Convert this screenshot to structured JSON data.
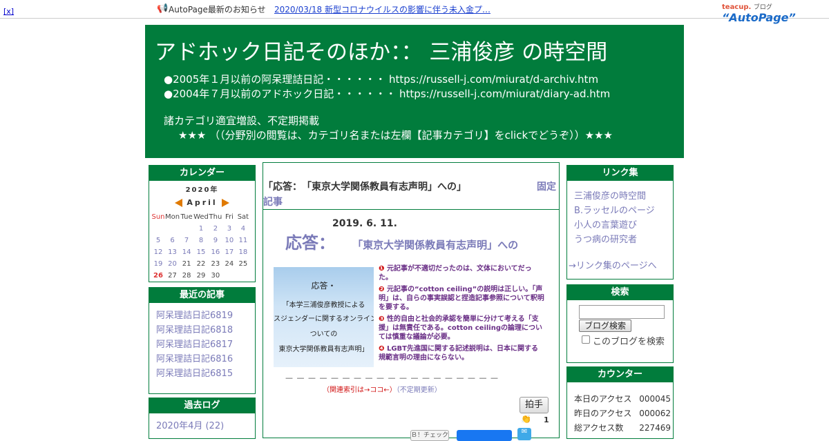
{
  "topbar": {
    "close": "[x]",
    "notice_label": "AutoPage最新のお知らせ",
    "notice_link": "2020/03/18 新型コロナウイルスの影響に伴う未入金プ…",
    "logo_teacup": "teacup.",
    "logo_blog": "ブログ",
    "logo_autopage": "“AutoPage”"
  },
  "header": {
    "title": "アドホック日記そのほか：： 三浦俊彦 の時空間",
    "line1": "●2005年１月以前の阿呆理詰日記・・・・・・ https://russell-j.com/miurat/d-archiv.htm",
    "line2": "●2004年７月以前のアドホック日記・・・・・・ https://russell-j.com/miurat/diary-ad.htm",
    "line3": "諸カテゴリ適宜増設、不定期掲載",
    "line4": "★★★ （（分野別の閲覧は、カテゴリ名または左欄【記事カテゴリ】をclickでどうぞ））★★★"
  },
  "calendar": {
    "title": "カレンダー",
    "year": "2020年",
    "month": "April",
    "weekdays": [
      "Sun",
      "Mon",
      "Tue",
      "Wed",
      "Thu",
      "Fri",
      "Sat"
    ],
    "weeks": [
      [
        "",
        "",
        "",
        "1",
        "2",
        "3",
        "4"
      ],
      [
        "5",
        "6",
        "7",
        "8",
        "9",
        "10",
        "11"
      ],
      [
        "12",
        "13",
        "14",
        "15",
        "16",
        "17",
        "18"
      ],
      [
        "19",
        "20",
        "21",
        "22",
        "23",
        "24",
        "25"
      ],
      [
        "26",
        "27",
        "28",
        "29",
        "30",
        "",
        ""
      ]
    ]
  },
  "recent": {
    "title": "最近の記事",
    "items": [
      "阿呆理詰日記6819",
      "阿呆理詰日記6818",
      "阿呆理詰日記6817",
      "阿呆理詰日記6816",
      "阿呆理詰日記6815"
    ]
  },
  "archive": {
    "title": "過去ログ",
    "items": [
      "2020年4月 (22)"
    ]
  },
  "post": {
    "title": "「応答：　「東京大学関係教員有志声明」への」",
    "fixed_a": "固定",
    "fixed_b": "記事",
    "date": "2019. 6. 11.",
    "heading_big": "応答：",
    "heading_small": "「東京大学関係教員有志声明」への",
    "thumb_lines": [
      "応答・",
      "「本学三浦俊彦教授による",
      "スジェンダーに関するオンライン記事",
      "ついての",
      "東京大学関係教員有志声明」"
    ],
    "points": [
      {
        "n": "❶",
        "t": "元記事が不適切だったのは、文体においてだった。"
      },
      {
        "n": "❷",
        "t": "元記事の“cotton ceiling”の説明は正しい。「声明」は、自らの事実誤認と捏造記事参照について釈明を要する。"
      },
      {
        "n": "❸",
        "t": "性的自由と社会的承認を簡単に分けて考える「支援」は無責任である。cotton ceilingの論理については慎重な議論が必要。"
      },
      {
        "n": "❹",
        "t": "LGBT先進国に関する記述説明は、日本に関する規範言明の理由にならない。"
      }
    ],
    "dashes": "— — — — — — — — — — — — — — — — — — —",
    "related": "（関連索引は→ココ←）",
    "related_update": "（不定期更新）",
    "clap_label": "拍手",
    "clap_count": "1",
    "share_label": "Ｂ！チェック"
  },
  "links": {
    "title": "リンク集",
    "items": [
      "三浦俊彦の時空間",
      "B.ラッセルのページ",
      "小人の言葉遊び",
      "うつ病の研究者"
    ],
    "more": "→リンク集のページへ"
  },
  "search": {
    "title": "検索",
    "button": "ブログ検索",
    "checkbox_label": "このブログを検索"
  },
  "counter": {
    "title": "カウンター",
    "rows": [
      {
        "label": "本日のアクセス",
        "value": "000045"
      },
      {
        "label": "昨日のアクセス",
        "value": "000062"
      },
      {
        "label": "総アクセス数",
        "value": "227469"
      }
    ]
  }
}
